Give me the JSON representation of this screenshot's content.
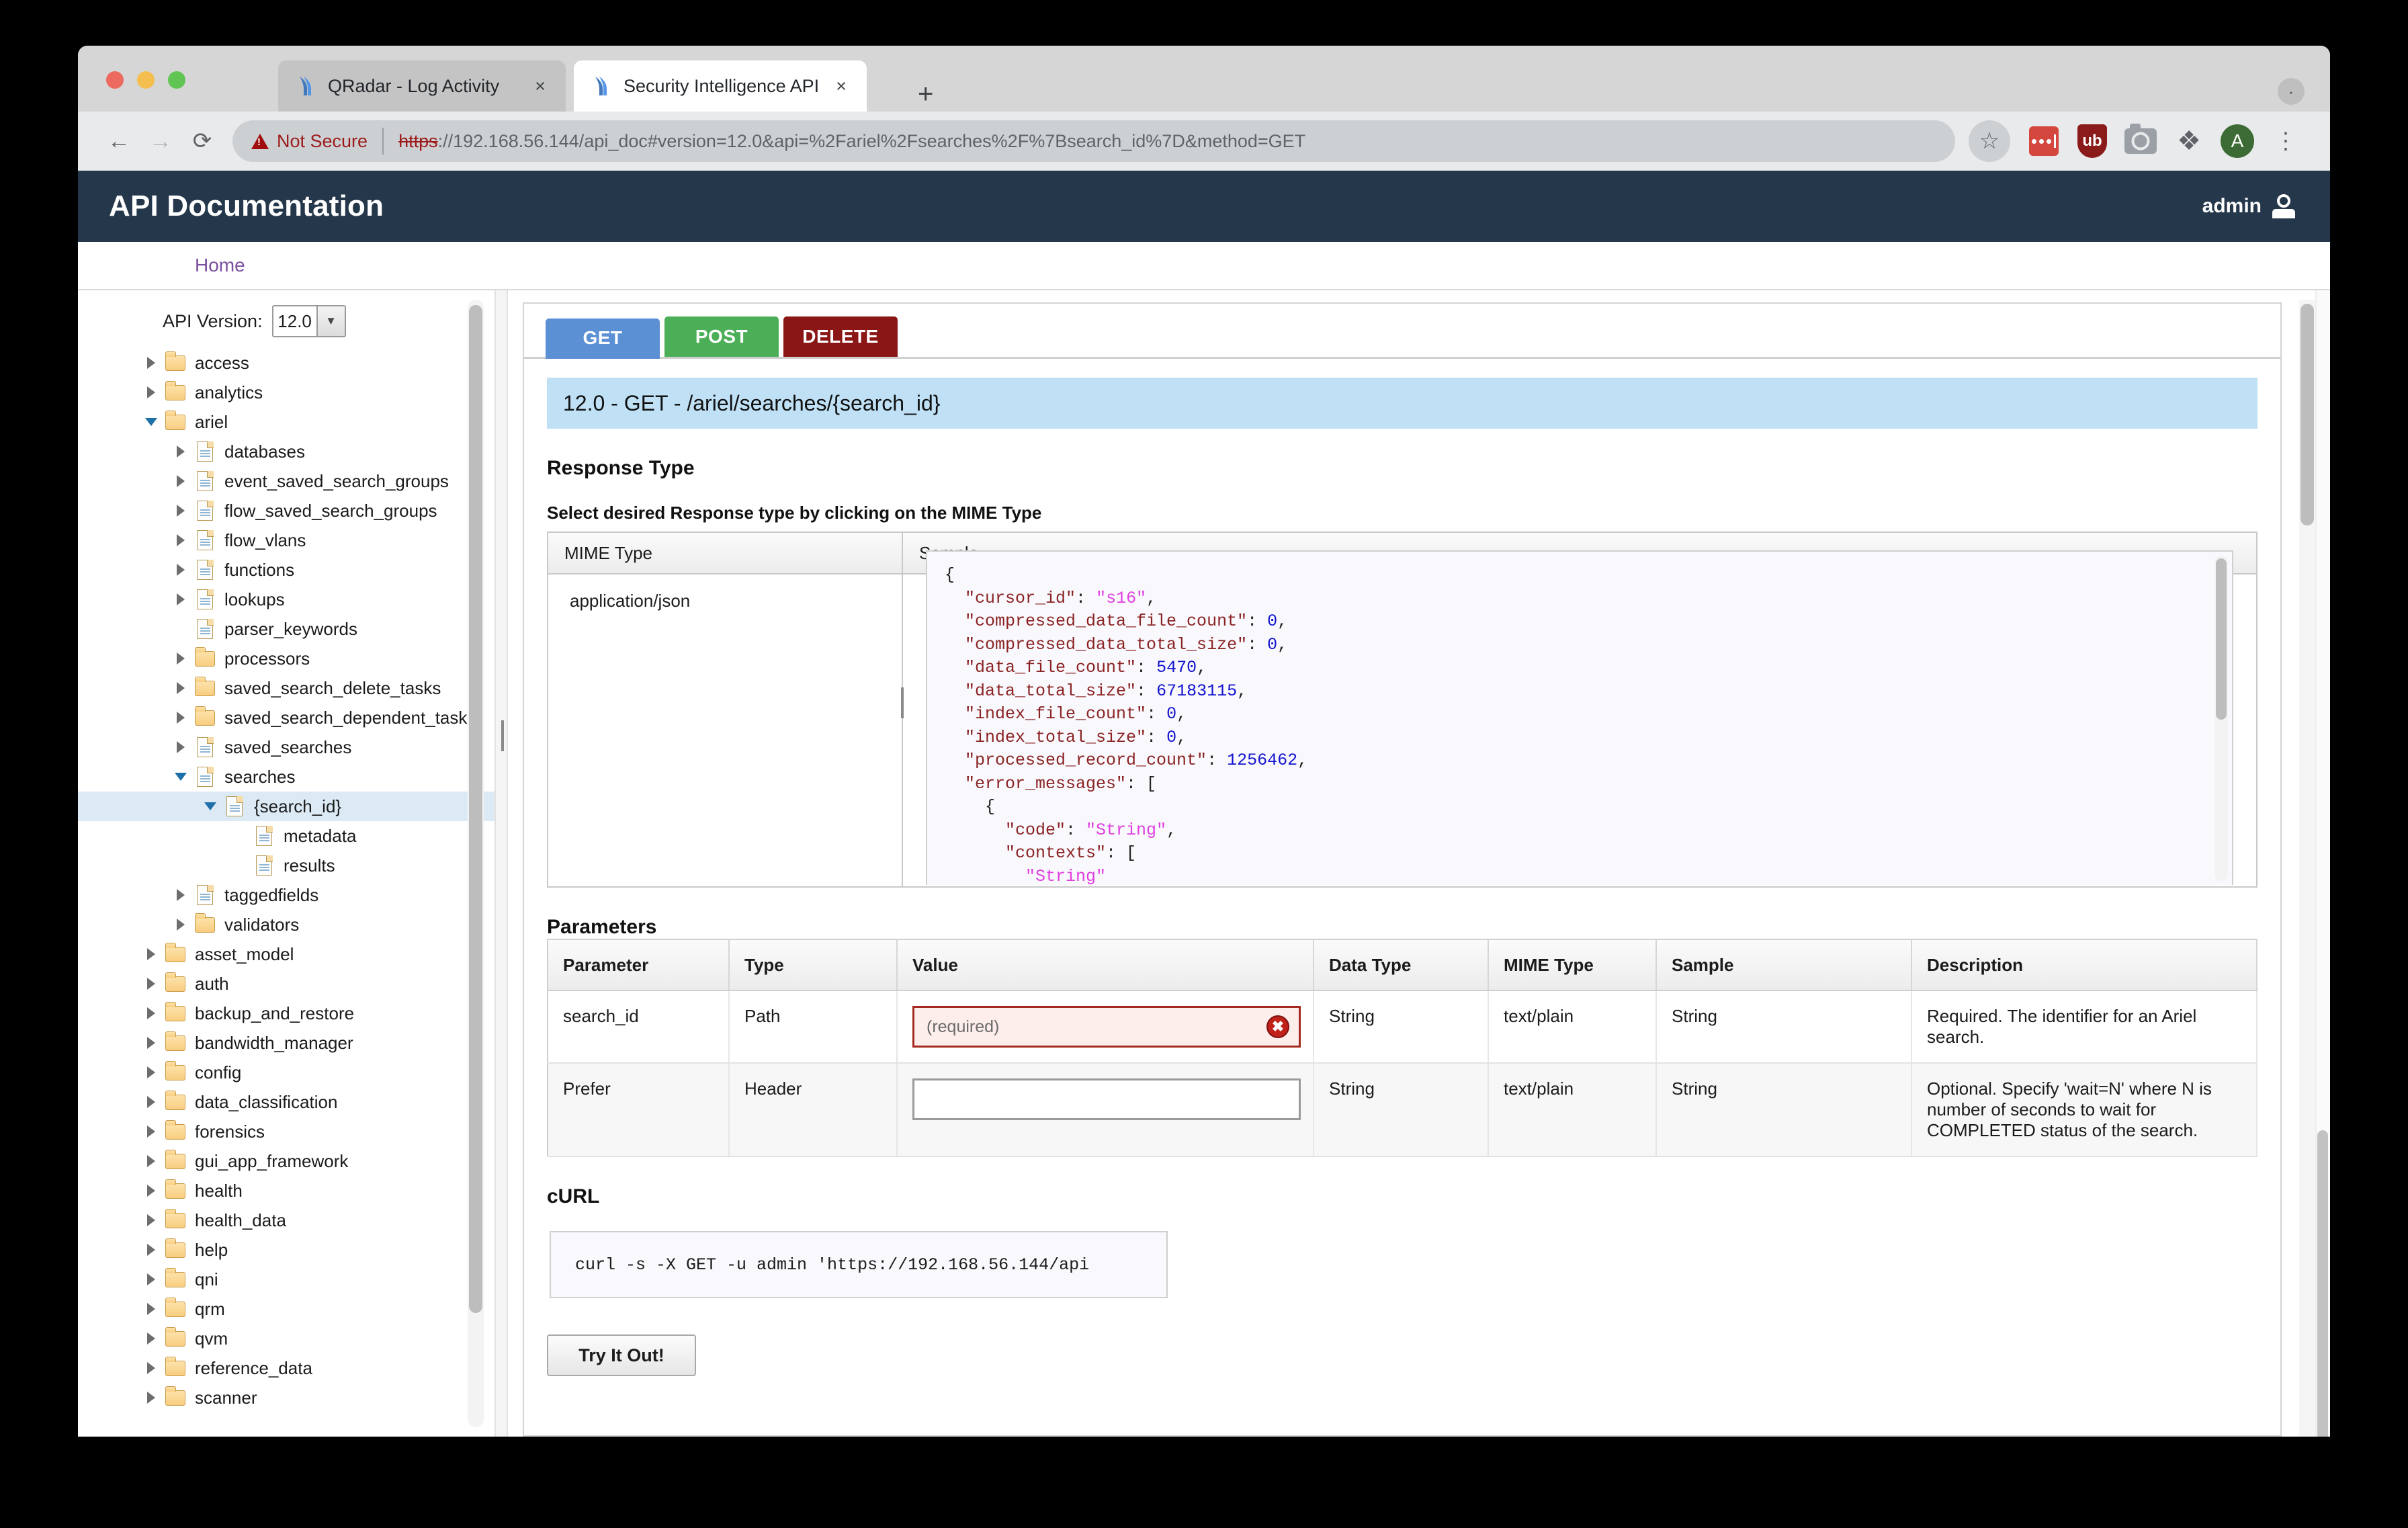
{
  "browser": {
    "tabs": [
      {
        "title": "QRadar - Log Activity",
        "favicon": "qradar-icon",
        "close": "×",
        "active": false
      },
      {
        "title": "Security Intelligence API",
        "favicon": "qradar-icon",
        "close": "×",
        "active": true
      }
    ],
    "new_tab": "+",
    "window_menu": "·",
    "nav": {
      "back": "←",
      "forward": "→",
      "reload": "⟳"
    },
    "omnibox": {
      "security_label": "Not Secure",
      "url_scheme": "https",
      "url_rest": "://192.168.56.144/api_doc#version=12.0&api=%2Fariel%2Fsearches%2F%7Bsearch_id%7D&method=GET",
      "bookmark_icon": "☆"
    },
    "extensions": [
      {
        "name": "lastpass-icon"
      },
      {
        "name": "ublock-origin-icon",
        "label": "ub"
      },
      {
        "name": "screenshot-camera-icon"
      },
      {
        "name": "extensions-puzzle-icon",
        "glyph": "❖"
      }
    ],
    "profile": {
      "initial": "A",
      "color": "#3d6b35"
    },
    "menu": "⋮"
  },
  "app": {
    "title": "API Documentation",
    "user": "admin",
    "breadcrumb": "Home",
    "header_color": "#25374a"
  },
  "sidebar": {
    "version_label": "API Version:",
    "version_value": "12.0",
    "version_arrow": "▼",
    "tree": [
      {
        "label": "access",
        "icon": "folder",
        "arrow": "right",
        "depth": 0
      },
      {
        "label": "analytics",
        "icon": "folder",
        "arrow": "right",
        "depth": 0
      },
      {
        "label": "ariel",
        "icon": "folder",
        "arrow": "down",
        "depth": 0
      },
      {
        "label": "databases",
        "icon": "doc",
        "arrow": "right",
        "depth": 1
      },
      {
        "label": "event_saved_search_groups",
        "icon": "doc",
        "arrow": "right",
        "depth": 1
      },
      {
        "label": "flow_saved_search_groups",
        "icon": "doc",
        "arrow": "right",
        "depth": 1
      },
      {
        "label": "flow_vlans",
        "icon": "doc",
        "arrow": "right",
        "depth": 1
      },
      {
        "label": "functions",
        "icon": "doc",
        "arrow": "right",
        "depth": 1
      },
      {
        "label": "lookups",
        "icon": "doc",
        "arrow": "right",
        "depth": 1
      },
      {
        "label": "parser_keywords",
        "icon": "doc",
        "arrow": "none",
        "depth": 1
      },
      {
        "label": "processors",
        "icon": "folder",
        "arrow": "right",
        "depth": 1
      },
      {
        "label": "saved_search_delete_tasks",
        "icon": "folder",
        "arrow": "right",
        "depth": 1
      },
      {
        "label": "saved_search_dependent_tasks",
        "icon": "folder",
        "arrow": "right",
        "depth": 1
      },
      {
        "label": "saved_searches",
        "icon": "doc",
        "arrow": "right",
        "depth": 1
      },
      {
        "label": "searches",
        "icon": "doc",
        "arrow": "down",
        "depth": 1
      },
      {
        "label": "{search_id}",
        "icon": "doc",
        "arrow": "down",
        "depth": 2,
        "selected": true
      },
      {
        "label": "metadata",
        "icon": "doc",
        "arrow": "none",
        "depth": 3
      },
      {
        "label": "results",
        "icon": "doc",
        "arrow": "none",
        "depth": 3
      },
      {
        "label": "taggedfields",
        "icon": "doc",
        "arrow": "right",
        "depth": 1
      },
      {
        "label": "validators",
        "icon": "folder",
        "arrow": "right",
        "depth": 1
      },
      {
        "label": "asset_model",
        "icon": "folder",
        "arrow": "right",
        "depth": 0
      },
      {
        "label": "auth",
        "icon": "folder",
        "arrow": "right",
        "depth": 0
      },
      {
        "label": "backup_and_restore",
        "icon": "folder",
        "arrow": "right",
        "depth": 0
      },
      {
        "label": "bandwidth_manager",
        "icon": "folder",
        "arrow": "right",
        "depth": 0
      },
      {
        "label": "config",
        "icon": "folder",
        "arrow": "right",
        "depth": 0
      },
      {
        "label": "data_classification",
        "icon": "folder",
        "arrow": "right",
        "depth": 0
      },
      {
        "label": "forensics",
        "icon": "folder",
        "arrow": "right",
        "depth": 0
      },
      {
        "label": "gui_app_framework",
        "icon": "folder",
        "arrow": "right",
        "depth": 0
      },
      {
        "label": "health",
        "icon": "folder",
        "arrow": "right",
        "depth": 0
      },
      {
        "label": "health_data",
        "icon": "folder",
        "arrow": "right",
        "depth": 0
      },
      {
        "label": "help",
        "icon": "folder",
        "arrow": "right",
        "depth": 0
      },
      {
        "label": "qni",
        "icon": "folder",
        "arrow": "right",
        "depth": 0
      },
      {
        "label": "qrm",
        "icon": "folder",
        "arrow": "right",
        "depth": 0
      },
      {
        "label": "qvm",
        "icon": "folder",
        "arrow": "right",
        "depth": 0
      },
      {
        "label": "reference_data",
        "icon": "folder",
        "arrow": "right",
        "depth": 0
      },
      {
        "label": "scanner",
        "icon": "folder",
        "arrow": "right",
        "depth": 0
      }
    ]
  },
  "content": {
    "methods": [
      {
        "label": "GET",
        "color": "#5b90d4",
        "active": true
      },
      {
        "label": "POST",
        "color": "#4caf58",
        "active": false
      },
      {
        "label": "DELETE",
        "color": "#8a1616",
        "active": false
      }
    ],
    "endpoint_banner": "12.0 - GET - /ariel/searches/{search_id}",
    "response_type": {
      "heading": "Response Type",
      "instruction": "Select desired Response type by clicking on the MIME Type",
      "mime_header": "MIME Type",
      "sample_header": "Sample",
      "mime_value": "application/json",
      "sample_lines": [
        [
          {
            "t": "{",
            "c": "jp"
          }
        ],
        [
          {
            "t": "  \"cursor_id\"",
            "c": "jk"
          },
          {
            "t": ": ",
            "c": "jp"
          },
          {
            "t": "\"s16\"",
            "c": "js"
          },
          {
            "t": ",",
            "c": "jp"
          }
        ],
        [
          {
            "t": "  \"compressed_data_file_count\"",
            "c": "jk"
          },
          {
            "t": ": ",
            "c": "jp"
          },
          {
            "t": "0",
            "c": "jn"
          },
          {
            "t": ",",
            "c": "jp"
          }
        ],
        [
          {
            "t": "  \"compressed_data_total_size\"",
            "c": "jk"
          },
          {
            "t": ": ",
            "c": "jp"
          },
          {
            "t": "0",
            "c": "jn"
          },
          {
            "t": ",",
            "c": "jp"
          }
        ],
        [
          {
            "t": "  \"data_file_count\"",
            "c": "jk"
          },
          {
            "t": ": ",
            "c": "jp"
          },
          {
            "t": "5470",
            "c": "jn"
          },
          {
            "t": ",",
            "c": "jp"
          }
        ],
        [
          {
            "t": "  \"data_total_size\"",
            "c": "jk"
          },
          {
            "t": ": ",
            "c": "jp"
          },
          {
            "t": "67183115",
            "c": "jn"
          },
          {
            "t": ",",
            "c": "jp"
          }
        ],
        [
          {
            "t": "  \"index_file_count\"",
            "c": "jk"
          },
          {
            "t": ": ",
            "c": "jp"
          },
          {
            "t": "0",
            "c": "jn"
          },
          {
            "t": ",",
            "c": "jp"
          }
        ],
        [
          {
            "t": "  \"index_total_size\"",
            "c": "jk"
          },
          {
            "t": ": ",
            "c": "jp"
          },
          {
            "t": "0",
            "c": "jn"
          },
          {
            "t": ",",
            "c": "jp"
          }
        ],
        [
          {
            "t": "  \"processed_record_count\"",
            "c": "jk"
          },
          {
            "t": ": ",
            "c": "jp"
          },
          {
            "t": "1256462",
            "c": "jn"
          },
          {
            "t": ",",
            "c": "jp"
          }
        ],
        [
          {
            "t": "  \"error_messages\"",
            "c": "jk"
          },
          {
            "t": ": [",
            "c": "jp"
          }
        ],
        [
          {
            "t": "    {",
            "c": "jp"
          }
        ],
        [
          {
            "t": "      \"code\"",
            "c": "jk"
          },
          {
            "t": ": ",
            "c": "jp"
          },
          {
            "t": "\"String\"",
            "c": "js"
          },
          {
            "t": ",",
            "c": "jp"
          }
        ],
        [
          {
            "t": "      \"contexts\"",
            "c": "jk"
          },
          {
            "t": ": [",
            "c": "jp"
          }
        ],
        [
          {
            "t": "        \"String\"",
            "c": "js"
          }
        ],
        [
          {
            "t": "      ]",
            "c": "jp"
          }
        ]
      ]
    },
    "parameters": {
      "heading": "Parameters",
      "columns": [
        "Parameter",
        "Type",
        "Value",
        "Data Type",
        "MIME Type",
        "Sample",
        "Description"
      ],
      "rows": [
        {
          "parameter": "search_id",
          "type": "Path",
          "value": "",
          "value_placeholder": "(required)",
          "value_state": "error",
          "error_glyph": "✖",
          "data_type": "String",
          "mime_type": "text/plain",
          "sample": "String",
          "description": "Required. The identifier for an Ariel search."
        },
        {
          "parameter": "Prefer",
          "type": "Header",
          "value": "",
          "value_placeholder": "",
          "value_state": "normal",
          "data_type": "String",
          "mime_type": "text/plain",
          "sample": "String",
          "description": "Optional. Specify 'wait=N' where N is number of seconds to wait for COMPLETED status of the search."
        }
      ]
    },
    "curl": {
      "heading": "cURL",
      "command": "curl -s -X GET -u admin 'https://192.168.56.144/api"
    },
    "try_it_label": "Try It Out!"
  }
}
